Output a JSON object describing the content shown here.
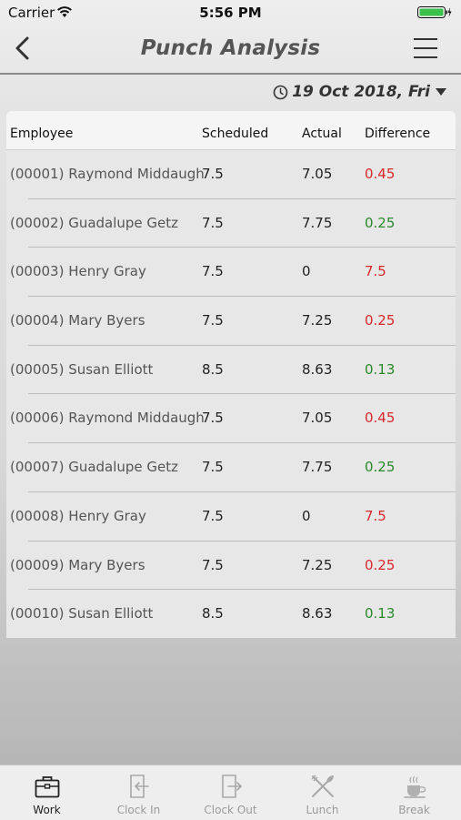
{
  "status_bar": {
    "carrier": "Carrier",
    "time": "5:56 PM"
  },
  "nav": {
    "title": "Punch Analysis"
  },
  "date_picker": {
    "value": "19 Oct 2018, Fri"
  },
  "table": {
    "headers": {
      "employee": "Employee",
      "scheduled": "Scheduled",
      "actual": "Actual",
      "difference": "Difference"
    },
    "rows": [
      {
        "employee": "(00001) Raymond Middaugh",
        "scheduled": "7.5",
        "actual": "7.05",
        "difference": "0.45",
        "status": "neg"
      },
      {
        "employee": "(00002) Guadalupe Getz",
        "scheduled": "7.5",
        "actual": "7.75",
        "difference": "0.25",
        "status": "pos"
      },
      {
        "employee": "(00003) Henry Gray",
        "scheduled": "7.5",
        "actual": "0",
        "difference": "7.5",
        "status": "neg"
      },
      {
        "employee": "(00004) Mary Byers",
        "scheduled": "7.5",
        "actual": "7.25",
        "difference": "0.25",
        "status": "neg"
      },
      {
        "employee": "(00005) Susan Elliott",
        "scheduled": "8.5",
        "actual": "8.63",
        "difference": "0.13",
        "status": "pos"
      },
      {
        "employee": "(00006) Raymond Middaugh",
        "scheduled": "7.5",
        "actual": "7.05",
        "difference": "0.45",
        "status": "neg"
      },
      {
        "employee": "(00007) Guadalupe Getz",
        "scheduled": "7.5",
        "actual": "7.75",
        "difference": "0.25",
        "status": "pos"
      },
      {
        "employee": "(00008) Henry Gray",
        "scheduled": "7.5",
        "actual": "0",
        "difference": "7.5",
        "status": "neg"
      },
      {
        "employee": "(00009) Mary Byers",
        "scheduled": "7.5",
        "actual": "7.25",
        "difference": "0.25",
        "status": "neg"
      },
      {
        "employee": "(00010) Susan Elliott",
        "scheduled": "8.5",
        "actual": "8.63",
        "difference": "0.13",
        "status": "pos"
      }
    ]
  },
  "colors": {
    "negative": "#d9282b",
    "positive": "#2a8a2a"
  },
  "tab_bar": {
    "items": [
      {
        "label": "Work",
        "icon": "briefcase-icon",
        "active": true
      },
      {
        "label": "Clock In",
        "icon": "clock-in-icon",
        "active": false
      },
      {
        "label": "Clock Out",
        "icon": "clock-out-icon",
        "active": false
      },
      {
        "label": "Lunch",
        "icon": "fork-knife-icon",
        "active": false
      },
      {
        "label": "Break",
        "icon": "coffee-cup-icon",
        "active": false
      }
    ]
  }
}
